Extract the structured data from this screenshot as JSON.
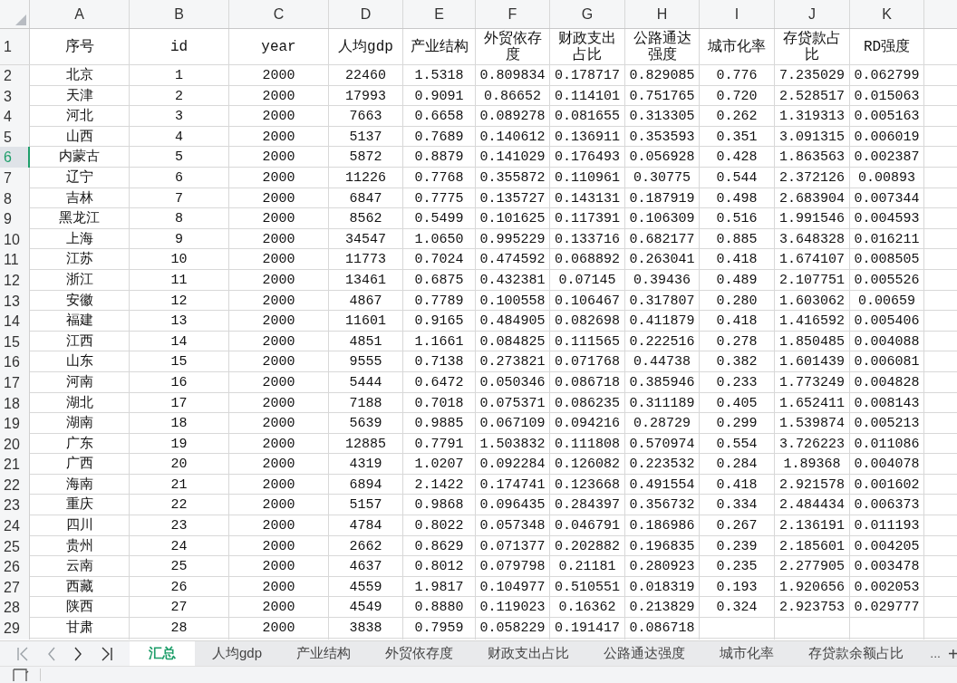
{
  "columns": [
    "A",
    "B",
    "C",
    "D",
    "E",
    "F",
    "G",
    "H",
    "I",
    "J",
    "K"
  ],
  "header_row": {
    "number": "1",
    "selected": false,
    "cells": [
      "序号",
      "id",
      "year",
      "人均gdp",
      "产业结构",
      "外贸依存度",
      "财政支出占比",
      "公路通达强度",
      "城市化率",
      "存贷款占比",
      "RD强度"
    ]
  },
  "rows": [
    {
      "number": "2",
      "selected": false,
      "cells": [
        "北京",
        "1",
        "2000",
        "22460",
        "1.5318",
        "0.809834",
        "0.178717",
        "0.829085",
        "0.776",
        "7.235029",
        "0.062799"
      ]
    },
    {
      "number": "3",
      "selected": false,
      "cells": [
        "天津",
        "2",
        "2000",
        "17993",
        "0.9091",
        "0.86652",
        "0.114101",
        "0.751765",
        "0.720",
        "2.528517",
        "0.015063"
      ]
    },
    {
      "number": "4",
      "selected": false,
      "cells": [
        "河北",
        "3",
        "2000",
        "7663",
        "0.6658",
        "0.089278",
        "0.081655",
        "0.313305",
        "0.262",
        "1.319313",
        "0.005163"
      ]
    },
    {
      "number": "5",
      "selected": false,
      "cells": [
        "山西",
        "4",
        "2000",
        "5137",
        "0.7689",
        "0.140612",
        "0.136911",
        "0.353593",
        "0.351",
        "3.091315",
        "0.006019"
      ]
    },
    {
      "number": "6",
      "selected": true,
      "cells": [
        "内蒙古",
        "5",
        "2000",
        "5872",
        "0.8879",
        "0.141029",
        "0.176493",
        "0.056928",
        "0.428",
        "1.863563",
        "0.002387"
      ]
    },
    {
      "number": "7",
      "selected": false,
      "cells": [
        "辽宁",
        "6",
        "2000",
        "11226",
        "0.7768",
        "0.355872",
        "0.110961",
        "0.30775",
        "0.544",
        "2.372126",
        "0.00893"
      ]
    },
    {
      "number": "8",
      "selected": false,
      "cells": [
        "吉林",
        "7",
        "2000",
        "6847",
        "0.7775",
        "0.135727",
        "0.143131",
        "0.187919",
        "0.498",
        "2.683904",
        "0.007344"
      ]
    },
    {
      "number": "9",
      "selected": false,
      "cells": [
        "黑龙江",
        "8",
        "2000",
        "8562",
        "0.5499",
        "0.101625",
        "0.117391",
        "0.106309",
        "0.516",
        "1.991546",
        "0.004593"
      ]
    },
    {
      "number": "10",
      "selected": false,
      "cells": [
        "上海",
        "9",
        "2000",
        "34547",
        "1.0650",
        "0.995229",
        "0.133716",
        "0.682177",
        "0.885",
        "3.648328",
        "0.016211"
      ]
    },
    {
      "number": "11",
      "selected": false,
      "cells": [
        "江苏",
        "10",
        "2000",
        "11773",
        "0.7024",
        "0.474592",
        "0.068892",
        "0.263041",
        "0.418",
        "1.674107",
        "0.008505"
      ]
    },
    {
      "number": "12",
      "selected": false,
      "cells": [
        "浙江",
        "11",
        "2000",
        "13461",
        "0.6875",
        "0.432381",
        "0.07145",
        "0.39436",
        "0.489",
        "2.107751",
        "0.005526"
      ]
    },
    {
      "number": "13",
      "selected": false,
      "cells": [
        "安徽",
        "12",
        "2000",
        "4867",
        "0.7789",
        "0.100558",
        "0.106467",
        "0.317807",
        "0.280",
        "1.603062",
        "0.00659"
      ]
    },
    {
      "number": "14",
      "selected": false,
      "cells": [
        "福建",
        "13",
        "2000",
        "11601",
        "0.9165",
        "0.484905",
        "0.082698",
        "0.411879",
        "0.418",
        "1.416592",
        "0.005406"
      ]
    },
    {
      "number": "15",
      "selected": false,
      "cells": [
        "江西",
        "14",
        "2000",
        "4851",
        "1.1661",
        "0.084825",
        "0.111565",
        "0.222516",
        "0.278",
        "1.850485",
        "0.004088"
      ]
    },
    {
      "number": "16",
      "selected": false,
      "cells": [
        "山东",
        "15",
        "2000",
        "9555",
        "0.7138",
        "0.273821",
        "0.071768",
        "0.44738",
        "0.382",
        "1.601439",
        "0.006081"
      ]
    },
    {
      "number": "17",
      "selected": false,
      "cells": [
        "河南",
        "16",
        "2000",
        "5444",
        "0.6472",
        "0.050346",
        "0.086718",
        "0.385946",
        "0.233",
        "1.773249",
        "0.004828"
      ]
    },
    {
      "number": "18",
      "selected": false,
      "cells": [
        "湖北",
        "17",
        "2000",
        "7188",
        "0.7018",
        "0.075371",
        "0.086235",
        "0.311189",
        "0.405",
        "1.652411",
        "0.008143"
      ]
    },
    {
      "number": "19",
      "selected": false,
      "cells": [
        "湖南",
        "18",
        "2000",
        "5639",
        "0.9885",
        "0.067109",
        "0.094216",
        "0.28729",
        "0.299",
        "1.539874",
        "0.005213"
      ]
    },
    {
      "number": "20",
      "selected": false,
      "cells": [
        "广东",
        "19",
        "2000",
        "12885",
        "0.7791",
        "1.503832",
        "0.111808",
        "0.570974",
        "0.554",
        "3.726223",
        "0.011086"
      ]
    },
    {
      "number": "21",
      "selected": false,
      "cells": [
        "广西",
        "20",
        "2000",
        "4319",
        "1.0207",
        "0.092284",
        "0.126082",
        "0.223532",
        "0.284",
        "1.89368",
        "0.004078"
      ]
    },
    {
      "number": "22",
      "selected": false,
      "cells": [
        "海南",
        "21",
        "2000",
        "6894",
        "2.1422",
        "0.174741",
        "0.123668",
        "0.491554",
        "0.418",
        "2.921578",
        "0.001602"
      ]
    },
    {
      "number": "23",
      "selected": false,
      "cells": [
        "重庆",
        "22",
        "2000",
        "5157",
        "0.9868",
        "0.096435",
        "0.284397",
        "0.356732",
        "0.334",
        "2.484434",
        "0.006373"
      ]
    },
    {
      "number": "24",
      "selected": false,
      "cells": [
        "四川",
        "23",
        "2000",
        "4784",
        "0.8022",
        "0.057348",
        "0.046791",
        "0.186986",
        "0.267",
        "2.136191",
        "0.011193"
      ]
    },
    {
      "number": "25",
      "selected": false,
      "cells": [
        "贵州",
        "24",
        "2000",
        "2662",
        "0.8629",
        "0.071377",
        "0.202882",
        "0.196835",
        "0.239",
        "2.185601",
        "0.004205"
      ]
    },
    {
      "number": "26",
      "selected": false,
      "cells": [
        "云南",
        "25",
        "2000",
        "4637",
        "0.8012",
        "0.079798",
        "0.21181",
        "0.280923",
        "0.235",
        "2.277905",
        "0.003478"
      ]
    },
    {
      "number": "27",
      "selected": false,
      "cells": [
        "西藏",
        "26",
        "2000",
        "4559",
        "1.9817",
        "0.104977",
        "0.510551",
        "0.018319",
        "0.193",
        "1.920656",
        "0.002053"
      ]
    },
    {
      "number": "28",
      "selected": false,
      "cells": [
        "陕西",
        "27",
        "2000",
        "4549",
        "0.8880",
        "0.119023",
        "0.16362",
        "0.213829",
        "0.324",
        "2.923753",
        "0.029777"
      ]
    },
    {
      "number": "29",
      "selected": false,
      "cells": [
        "甘肃",
        "28",
        "2000",
        "3838",
        "0.7959",
        "0.058229",
        "0.191417",
        "0.086718"
      ]
    }
  ],
  "sheet_tabs": [
    {
      "label": "汇总",
      "selected": true
    },
    {
      "label": "人均gdp",
      "selected": false
    },
    {
      "label": "产业结构",
      "selected": false
    },
    {
      "label": "外贸依存度",
      "selected": false
    },
    {
      "label": "财政支出占比",
      "selected": false
    },
    {
      "label": "公路通达强度",
      "selected": false
    },
    {
      "label": "城市化率",
      "selected": false
    },
    {
      "label": "存贷款余额占比",
      "selected": false
    }
  ],
  "tab_overflow": "...",
  "add_sheet": "+"
}
